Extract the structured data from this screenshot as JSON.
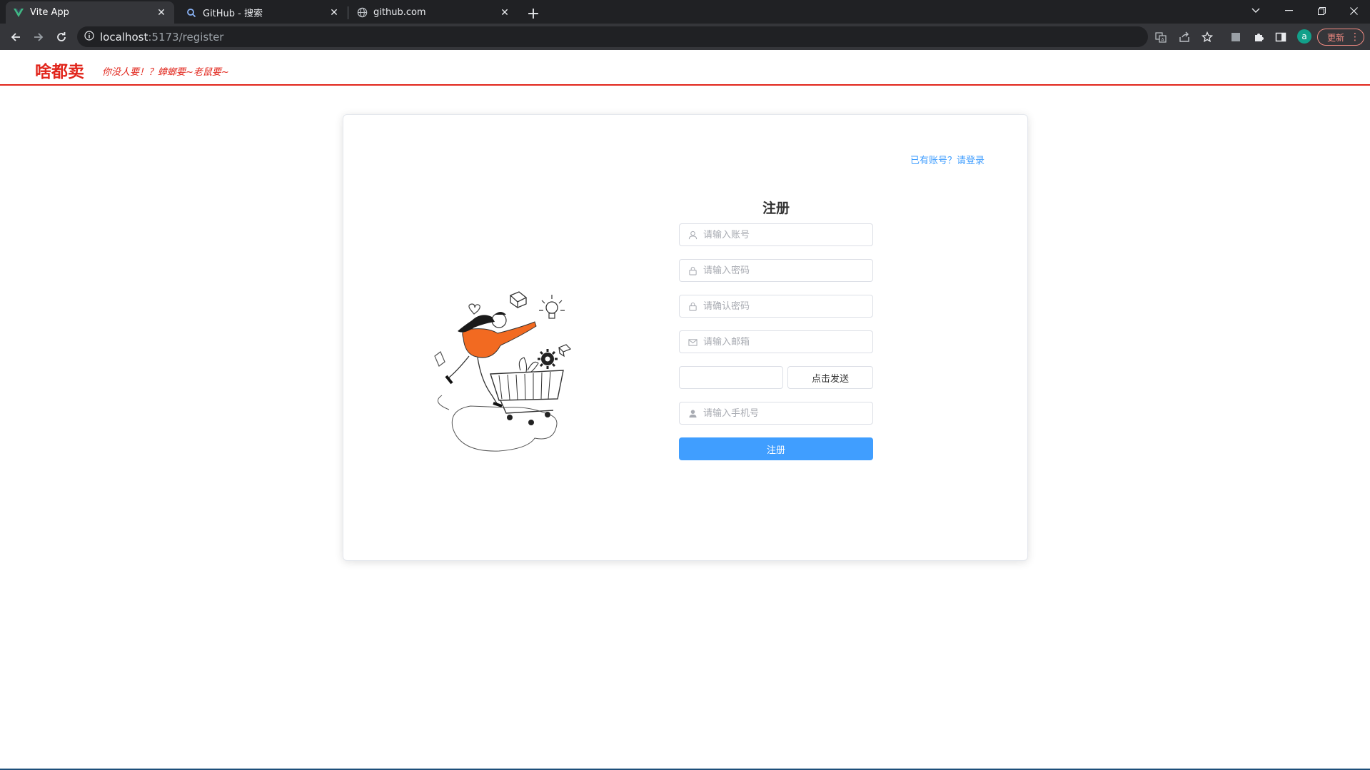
{
  "browser": {
    "tabs": [
      {
        "title": "Vite App",
        "icon": "vite-icon",
        "active": true
      },
      {
        "title": "GitHub - 搜索",
        "icon": "search-icon",
        "active": false
      },
      {
        "title": "github.com",
        "icon": "globe-icon",
        "active": false
      }
    ],
    "url_host": "localhost",
    "url_path": ":5173/register",
    "profile_initial": "a",
    "update_label": "更新"
  },
  "header": {
    "logo": "啥都卖",
    "slogan": "你没人要！？蟑螂要~老鼠要~"
  },
  "register": {
    "login_link": "已有账号？请登录",
    "title": "注册",
    "username_placeholder": "请输入账号",
    "password_placeholder": "请输入密码",
    "confirm_placeholder": "请确认密码",
    "email_placeholder": "请输入邮箱",
    "code_value": "",
    "send_label": "点击发送",
    "phone_placeholder": "请输入手机号",
    "submit_label": "注册"
  },
  "colors": {
    "brand": "#e1251b",
    "primary": "#409eff",
    "chrome_dark": "#202124",
    "chrome_toolbar": "#35363a"
  }
}
